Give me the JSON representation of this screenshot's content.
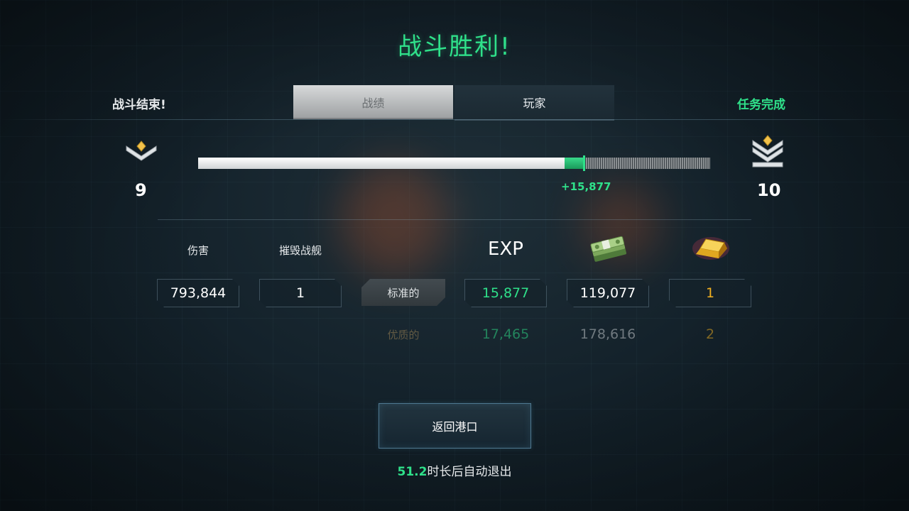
{
  "title": "战斗胜利!",
  "header": {
    "battle_over": "战斗结束!",
    "mission_complete": "任务完成"
  },
  "tabs": [
    {
      "label": "战绩",
      "active": true
    },
    {
      "label": "玩家",
      "active": false
    }
  ],
  "rank": {
    "current_level": "9",
    "next_level": "10",
    "current_icon": "rank-chevron-1-icon",
    "next_icon": "rank-chevron-3-icon"
  },
  "xp_bar": {
    "base_fraction": 0.715,
    "gain_fraction": 0.04,
    "gain_label": "+15,877"
  },
  "stats": {
    "damage_label": "伤害",
    "damage_value": "793,844",
    "kills_label": "摧毁战舰",
    "kills_value": "1"
  },
  "rewards": {
    "exp_header": "EXP",
    "cash_icon": "cash-stack-icon",
    "gold_icon": "gold-bar-icon",
    "standard": {
      "label": "标准的",
      "exp": "15,877",
      "cash": "119,077",
      "gold": "1"
    },
    "premium": {
      "label": "优质的",
      "exp": "17,465",
      "cash": "178,616",
      "gold": "2"
    }
  },
  "footer": {
    "return_button": "返回港口",
    "countdown": "51.2",
    "countdown_suffix": "时长后自动退出"
  },
  "colors": {
    "accent_green": "#2fe08a",
    "gold": "#f0b020",
    "background": "#14222b"
  }
}
